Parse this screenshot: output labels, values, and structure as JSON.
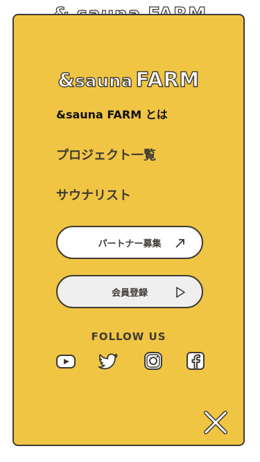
{
  "background_logo": "& sauna FARM",
  "logo": {
    "amp": "&",
    "sauna": "sauna",
    "farm": "FARM"
  },
  "nav": {
    "about": "&sauna FARM とは",
    "projects": "プロジェクト一覧",
    "saunalist": "サウナリスト"
  },
  "buttons": {
    "partner": "パートナー募集",
    "member": "会員登録"
  },
  "follow_label": "FOLLOW US",
  "icons": [
    "arrow-up-right-icon",
    "play-triangle-icon",
    "youtube-icon",
    "twitter-icon",
    "instagram-icon",
    "facebook-icon",
    "close-icon"
  ],
  "colors": {
    "panel": "#f0c544",
    "outline": "#3e3a33",
    "white": "#ffffff"
  }
}
